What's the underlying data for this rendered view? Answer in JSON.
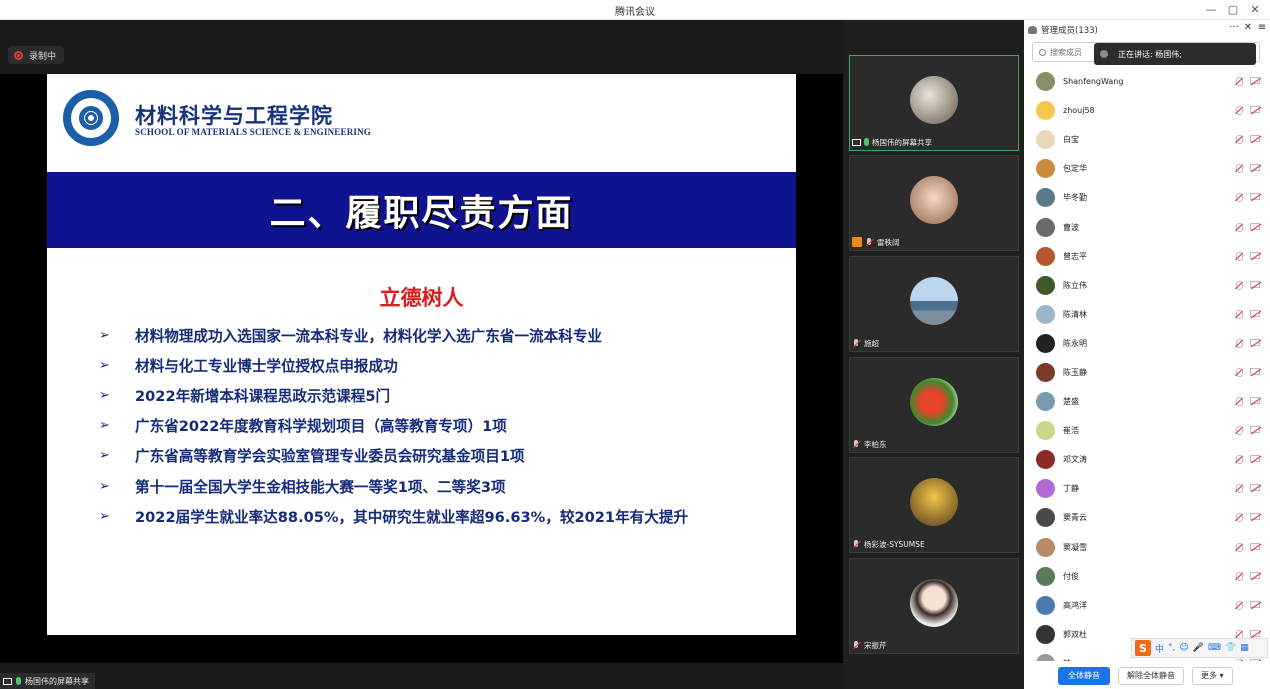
{
  "window": {
    "title": "腾讯会议",
    "minimize": "—",
    "maximize": "▢",
    "close": "✕"
  },
  "recording": {
    "label": "录制中",
    "color": "#e33b3b"
  },
  "slide": {
    "school_cn": "材料科学与工程学院",
    "school_en": "SCHOOL OF MATERIALS SCIENCE & ENGINEERING",
    "banner": "二、履职尽责方面",
    "subheading": "立德树人",
    "bullet_symbol": "➢",
    "bullets": [
      "材料物理成功入选国家一流本科专业，材料化学入选广东省一流本科专业",
      "材料与化工专业博士学位授权点申报成功",
      "2022年新增本科课程思政示范课程5门",
      "广东省2022年度教育科学规划项目（高等教育专项）1项",
      "广东省高等教育学会实验室管理专业委员会研究基金项目1项",
      "第十一届全国大学生金相技能大赛一等奖1项、二等奖3项",
      "2022届学生就业率达88.05%，其中研究生就业率超96.63%，较2021年有大提升"
    ],
    "banner_color": "#10138f",
    "subheading_color": "#d81e1e"
  },
  "video_tiles": [
    {
      "name": "杨国伟的屏幕共享"
    },
    {
      "name": "雷秩阔"
    },
    {
      "name": "施超"
    },
    {
      "name": "李柏东"
    },
    {
      "name": "杨彩波-SYSUMSE"
    },
    {
      "name": "宋振芹"
    }
  ],
  "panel": {
    "title": "管理成员(133)",
    "more": "···",
    "close": "✕",
    "menu": "≡",
    "search_placeholder": "搜索成员",
    "speaking": "正在讲话: 杨国伟;",
    "members": [
      "ShanfengWang",
      "zhouj58",
      "白宝",
      "包定华",
      "毕冬勤",
      "曹波",
      "曾志平",
      "陈立伟",
      "陈清林",
      "陈永明",
      "陈玉静",
      "楚盛",
      "崔浩",
      "邓文涛",
      "丁静",
      "窦青云",
      "窦凝雪",
      "付俊",
      "高鸿洋",
      "郭双杜",
      "韩"
    ],
    "mute_all": "全体静音",
    "unmute_all": "解除全体静音",
    "more_menu": "更多 ▾"
  },
  "ime": {
    "logo": "S",
    "mode": "中",
    "punct": "°,",
    "tools": [
      "☺",
      "🎤",
      "⌨",
      "👕",
      "▦"
    ]
  },
  "share_label": "杨国伟的屏幕共享"
}
